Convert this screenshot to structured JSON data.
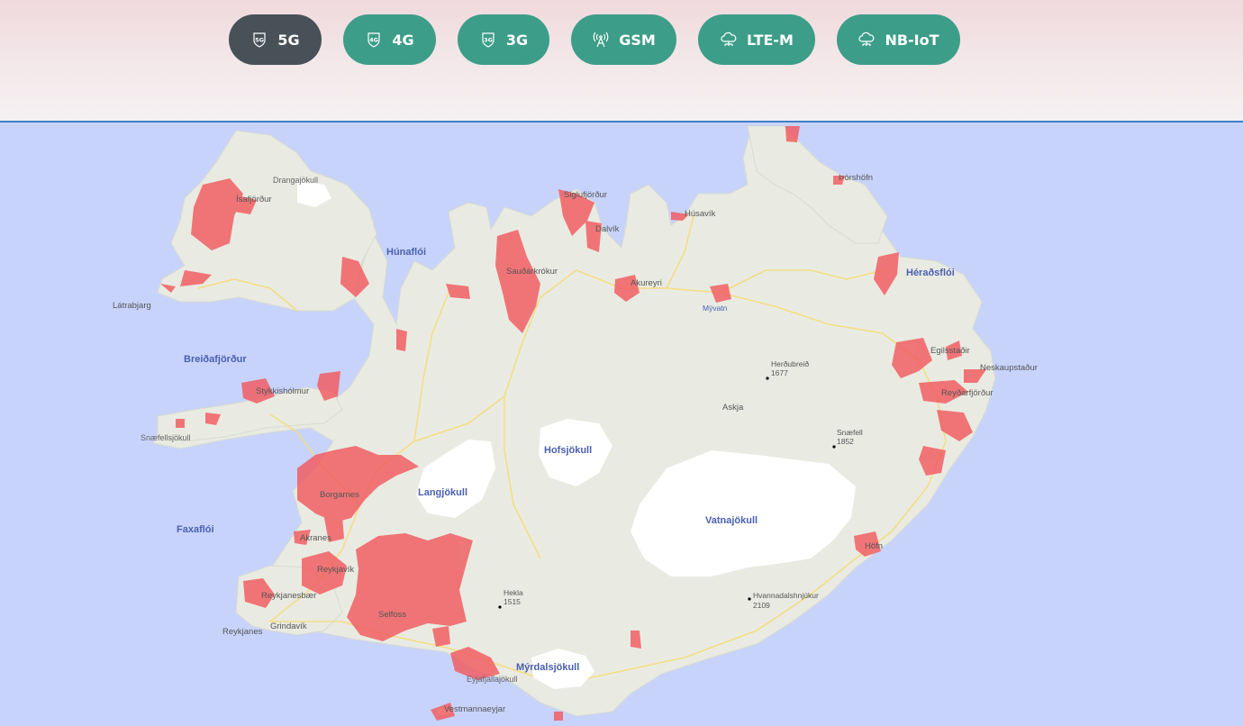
{
  "tabs": [
    {
      "label": "5G",
      "icon": "5g-icon",
      "active": true
    },
    {
      "label": "4G",
      "icon": "4g-icon",
      "active": false
    },
    {
      "label": "3G",
      "icon": "3g-icon",
      "active": false
    },
    {
      "label": "GSM",
      "icon": "antenna-icon",
      "active": false
    },
    {
      "label": "LTE-M",
      "icon": "cloud-network-icon",
      "active": false
    },
    {
      "label": "NB-IoT",
      "icon": "cloud-network-icon",
      "active": false
    }
  ],
  "icon_badges": {
    "b5g": "5G",
    "b4g": "4G",
    "b3g": "3G"
  },
  "colors": {
    "active_tab": "#475157",
    "tab": "#3c9d88",
    "water": "#c7d3fb",
    "land": "#e9ebe2",
    "glacier": "#ffffff",
    "coverage": "#f25a5f"
  },
  "map": {
    "water_labels": {
      "hunafloi": "Húnaflói",
      "breidafjordur": "Breiðafjörður",
      "faxafloi": "Faxaflói",
      "heradsfloi": "Héraðsflói"
    },
    "glaciers": {
      "drangajokull": "Drangajökull",
      "langjokull": "Langjökull",
      "hofsjokull": "Hofsjökull",
      "vatnajokull": "Vatnajökull",
      "myrdalsjokull": "Mýrdalsjökull",
      "eyjafjallajokull": "Eyjafjallajökull",
      "snaefellsjokull": "Snæfellsjökull"
    },
    "places": {
      "isafjordur": "Ísafjörður",
      "latrabjarg": "Látrabjarg",
      "siglufjordur": "Siglufjörður",
      "dalvik": "Dalvík",
      "husavik": "Húsavík",
      "thorshofn": "Þórshöfn",
      "saudarkrokur": "Sauðárkrókur",
      "akureyri": "Akureyri",
      "myvatn": "Mývatn",
      "stykkisholmur": "Stykkishólmur",
      "egilsstadir": "Egilsstaðir",
      "neskaupstadur": "Neskaupstaður",
      "reydarfjordur": "Reyðarfjörður",
      "askja": "Askja",
      "borgarnes": "Borgarnes",
      "akranes": "Akranes",
      "reykjavik": "Reykjavík",
      "reykjanesbaer": "Reykjanesbær",
      "grindavik": "Grindavík",
      "reykjanes": "Reykjanes",
      "selfoss": "Selfoss",
      "hofn": "Höfn",
      "vestmannaeyjar": "Vestmannaeyjar"
    },
    "peaks": [
      {
        "name": "Herðubreið",
        "elev": "1677"
      },
      {
        "name": "Snæfell",
        "elev": "1852"
      },
      {
        "name": "Hekla",
        "elev": "1515"
      },
      {
        "name": "Hvannadalshnjúkur",
        "elev": "2109"
      }
    ]
  }
}
